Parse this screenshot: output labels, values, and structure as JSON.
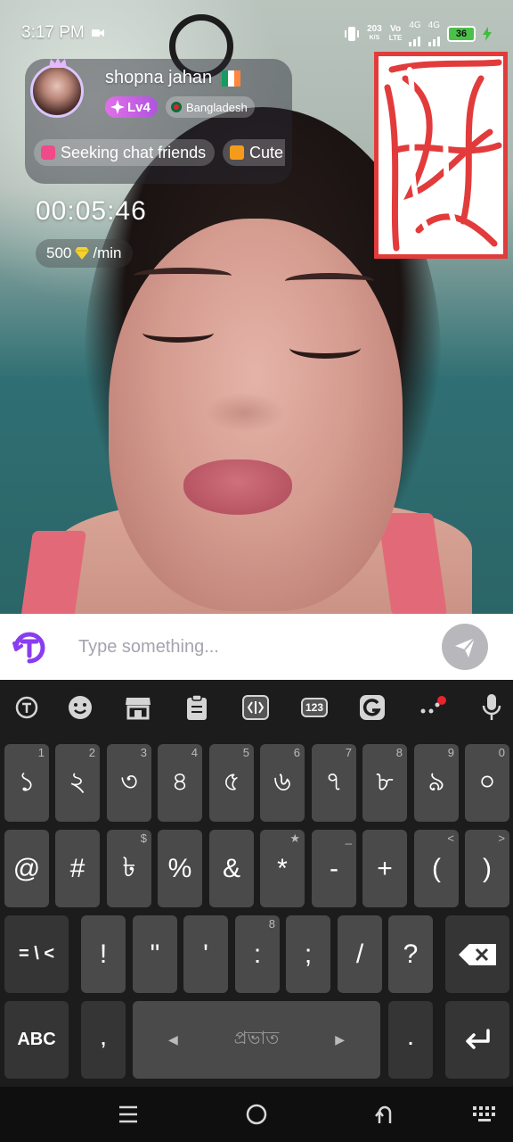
{
  "status": {
    "time": "3:17 PM",
    "speed_value": "203",
    "speed_unit": "K/S",
    "volte_top": "Vo",
    "volte_bottom": "LTE",
    "net1": "4G",
    "net2": "4G",
    "battery": "36"
  },
  "profile": {
    "username": "shopna jahan",
    "level": "Lv4",
    "country": "Bangladesh",
    "tag_1": "Seeking chat friends",
    "tag_2": "Cute"
  },
  "call": {
    "timer": "00:05:46",
    "rate_value": "500",
    "rate_unit": "/min"
  },
  "input": {
    "placeholder": "Type something..."
  },
  "keyboard": {
    "toolbar": [
      "translate-icon",
      "emoji-icon",
      "store-icon",
      "clipboard-icon",
      "text-cursor-icon",
      "numpad-icon",
      "grammar-icon",
      "more-icon",
      "mic-icon"
    ],
    "numpad_label": "123",
    "row1": [
      {
        "k": "১",
        "h": "1"
      },
      {
        "k": "২",
        "h": "2"
      },
      {
        "k": "৩",
        "h": "3"
      },
      {
        "k": "৪",
        "h": "4"
      },
      {
        "k": "৫",
        "h": "5"
      },
      {
        "k": "৬",
        "h": "6"
      },
      {
        "k": "৭",
        "h": "7"
      },
      {
        "k": "৮",
        "h": "8"
      },
      {
        "k": "৯",
        "h": "9"
      },
      {
        "k": "০",
        "h": "0"
      }
    ],
    "row2": [
      {
        "k": "@",
        "h": ""
      },
      {
        "k": "#",
        "h": ""
      },
      {
        "k": "৳",
        "h": "$"
      },
      {
        "k": "%",
        "h": ""
      },
      {
        "k": "&",
        "h": ""
      },
      {
        "k": "*",
        "h": "★"
      },
      {
        "k": "-",
        "h": "_"
      },
      {
        "k": "+",
        "h": ""
      },
      {
        "k": "(",
        "h": "<"
      },
      {
        "k": ")",
        "h": ">"
      }
    ],
    "row3_shift": "= \\ <",
    "row3": [
      {
        "k": "!",
        "h": ""
      },
      {
        "k": "\"",
        "h": ""
      },
      {
        "k": "'",
        "h": ""
      },
      {
        "k": ":",
        "h": "8"
      },
      {
        "k": ";",
        "h": ""
      },
      {
        "k": "/",
        "h": ""
      },
      {
        "k": "?",
        "h": ""
      }
    ],
    "abc": "ABC",
    "comma": ",",
    "space_label": "প্রভাত",
    "period": "."
  },
  "colors": {
    "accent": "#8a3df0",
    "level_badge": "#c860e8",
    "keyboard_bg": "#1c1c1c",
    "key_bg": "#4a4a4a"
  }
}
